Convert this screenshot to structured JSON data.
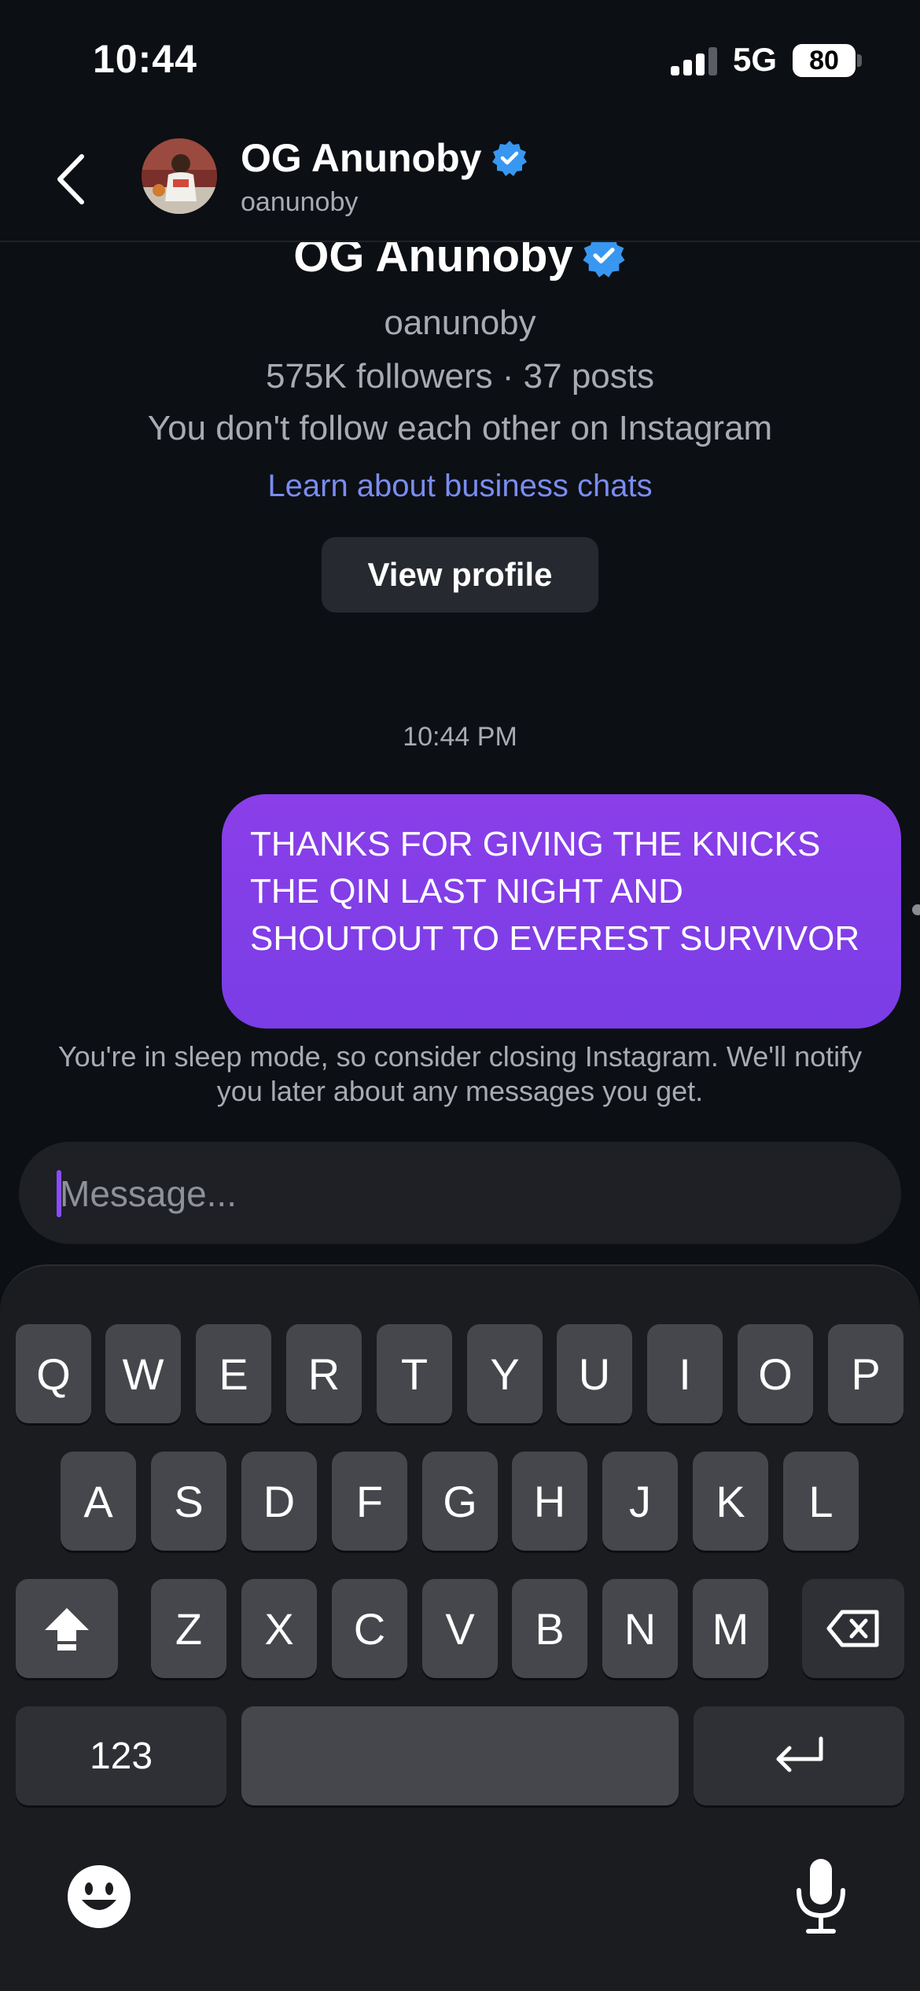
{
  "status_bar": {
    "time": "10:44",
    "network": "5G",
    "battery": "80"
  },
  "header": {
    "name": "OG Anunoby",
    "username": "oanunoby"
  },
  "profile": {
    "name": "OG Anunoby",
    "username": "oanunoby",
    "stats": "575K followers · 37 posts",
    "follow_status": "You don't follow each other on Instagram",
    "business_link": "Learn about business chats",
    "view_profile_label": "View profile"
  },
  "thread": {
    "timestamp": "10:44 PM",
    "messages": [
      {
        "text": "THANKS FOR GIVING THE KNICKS THE QIN LAST NIGHT AND SHOUTOUT TO EVEREST SURVIVOR",
        "from": "me"
      }
    ],
    "sleep_notice": "You're in sleep mode, so consider closing Instagram. We'll notify you later about any messages you get."
  },
  "composer": {
    "placeholder": "Message...",
    "value": ""
  },
  "keyboard": {
    "row1": [
      "Q",
      "W",
      "E",
      "R",
      "T",
      "Y",
      "U",
      "I",
      "O",
      "P"
    ],
    "row2": [
      "A",
      "S",
      "D",
      "F",
      "G",
      "H",
      "J",
      "K",
      "L"
    ],
    "row3": [
      "Z",
      "X",
      "C",
      "V",
      "B",
      "N",
      "M"
    ],
    "numbers_label": "123",
    "shift_icon": "shift-icon",
    "delete_icon": "backspace-icon",
    "return_icon": "return-icon",
    "emoji_icon": "emoji-icon",
    "mic_icon": "microphone-icon"
  },
  "colors": {
    "background": "#0c0f14",
    "bubble": "#8a3fe8",
    "link": "#7b8cf0",
    "verified": "#3897f0"
  }
}
